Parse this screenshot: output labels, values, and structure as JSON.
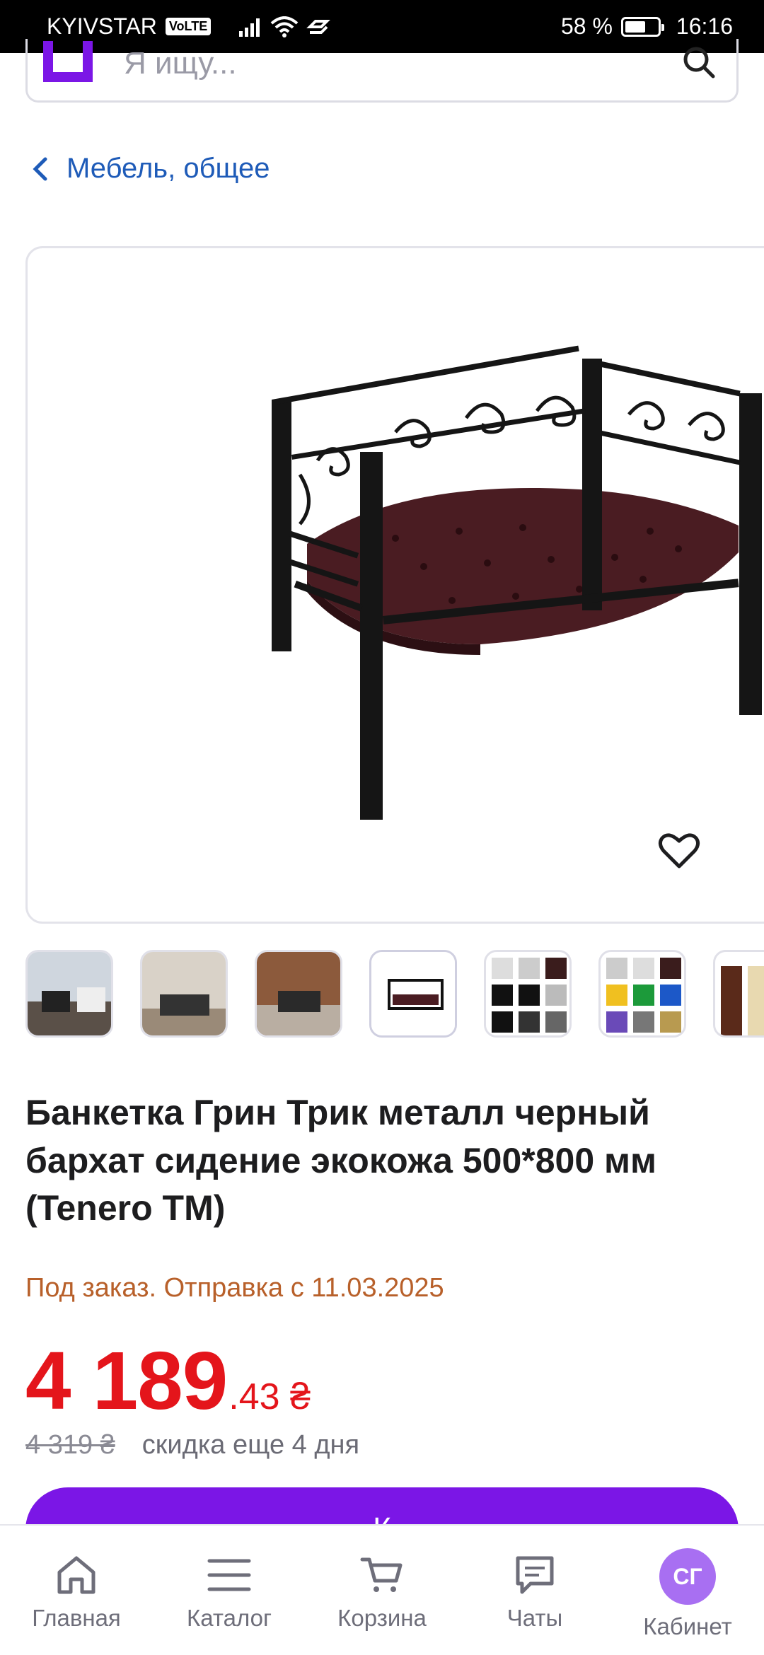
{
  "status_bar": {
    "carrier": "KYIVSTAR",
    "volte": "VoLTE",
    "battery": "58 %",
    "time": "16:16"
  },
  "search": {
    "placeholder": "Я ищу..."
  },
  "breadcrumb": {
    "label": "Мебель, общее"
  },
  "product": {
    "title": "Банкетка Грин Трик металл черный бархат сидение экокожа 500*800 мм (Tenero TM)",
    "availability": "Под заказ. Отправка с 11.03.2025",
    "price_main": "4 189",
    "price_cents": ".43 ₴",
    "old_price": "4 319 ₴",
    "discount_note": "скидка еще 4 дня",
    "buy_label": "К"
  },
  "bottom_nav": {
    "home": "Главная",
    "catalog": "Каталог",
    "cart": "Корзина",
    "chats": "Чаты",
    "cabinet": "Кабинет",
    "avatar_initials": "СГ"
  },
  "colors": {
    "brand_purple": "#7b16e6",
    "price_red": "#e4151b",
    "link_blue": "#1e5bb8",
    "availability_orange": "#b8602a"
  }
}
